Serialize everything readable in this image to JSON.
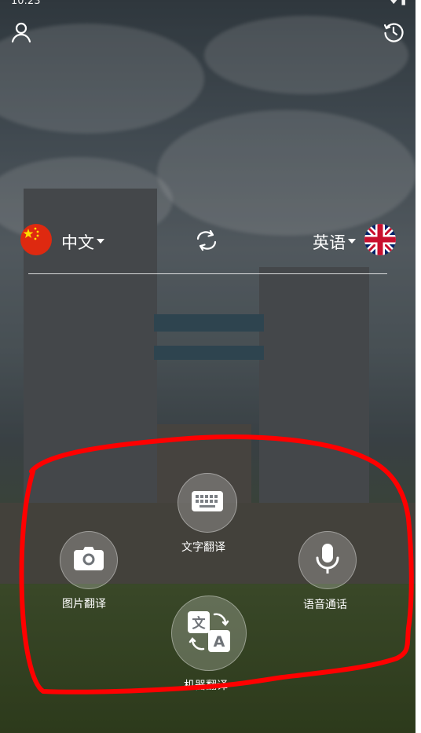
{
  "status_bar": {
    "time": "10:23"
  },
  "header": {
    "profile_icon": "user-icon",
    "history_icon": "history-clock-icon"
  },
  "languages": {
    "source": {
      "label": "中文",
      "flag": "china-flag"
    },
    "target": {
      "label": "英语",
      "flag": "uk-flag"
    },
    "swap_icon": "swap-icon"
  },
  "actions": {
    "text": {
      "label": "文字翻译",
      "icon": "keyboard-icon"
    },
    "photo": {
      "label": "图片翻译",
      "icon": "camera-icon"
    },
    "voice": {
      "label": "语音通话",
      "icon": "microphone-icon"
    },
    "machine": {
      "label": "机器翻译",
      "icon": "translate-icon"
    }
  },
  "colors": {
    "accent_white": "#ffffff",
    "annotation_red": "#ff0000"
  }
}
